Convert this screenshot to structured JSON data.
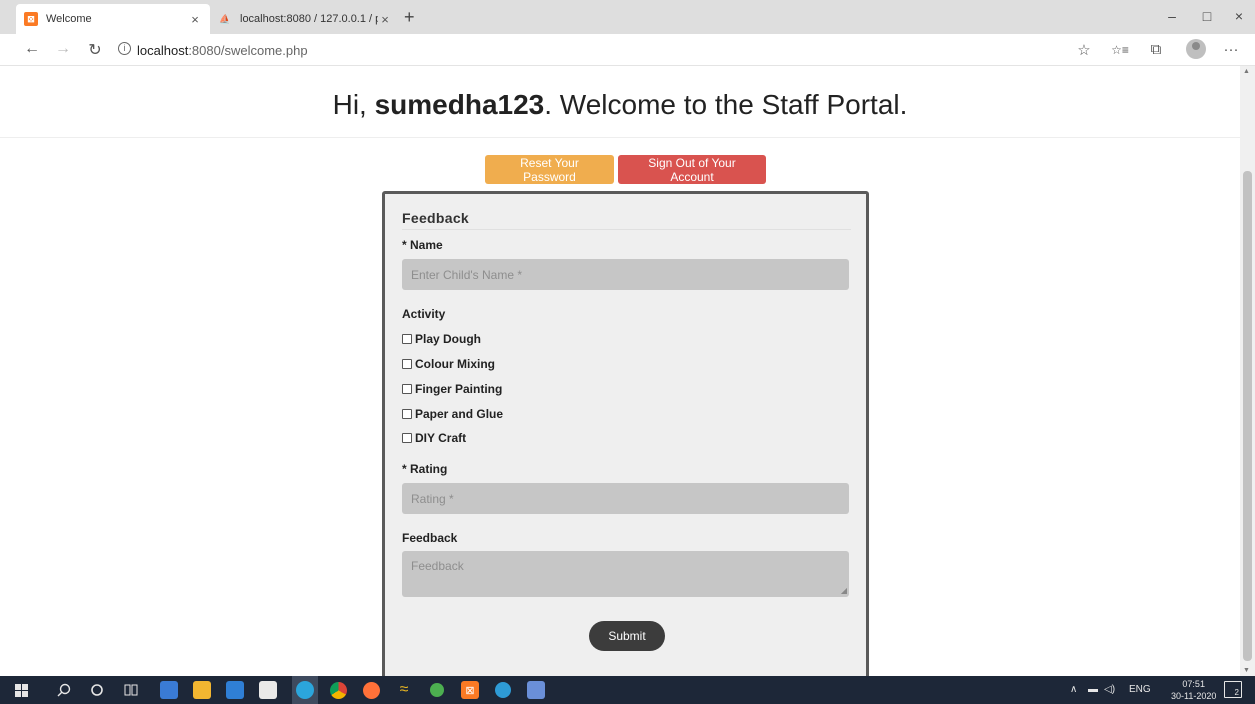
{
  "browser": {
    "tabs": [
      {
        "title": "Welcome",
        "close": "×"
      },
      {
        "title": "localhost:8080 / 127.0.0.1 / paren",
        "close": "×"
      }
    ],
    "new_tab": "+",
    "window_controls": {
      "minimize": "–",
      "maximize": "□",
      "close": "×"
    },
    "nav": {
      "back": "←",
      "forward": "→",
      "refresh": "↻"
    },
    "url_host": "localhost",
    "url_path": ":8080/swelcome.php",
    "toolbar": {
      "favorite": "☆",
      "favorites_list": "☆≡",
      "collections": "⧉",
      "more": "···"
    }
  },
  "page": {
    "greeting_prefix": "Hi, ",
    "username": "sumedha123",
    "greeting_suffix": ". Welcome to the Staff Portal.",
    "reset_password_label": "Reset Your Password",
    "sign_out_label": "Sign Out of Your Account",
    "form": {
      "legend": "Feedback",
      "name_label": "* Name",
      "name_placeholder": "Enter Child's Name *",
      "activity_label": "Activity",
      "activities": [
        "Play Dough",
        "Colour Mixing",
        "Finger Painting",
        "Paper and Glue",
        "DIY Craft"
      ],
      "rating_label": "* Rating",
      "rating_placeholder": "Rating *",
      "feedback_label": "Feedback",
      "feedback_placeholder": "Feedback",
      "submit_label": "Submit"
    }
  },
  "taskbar": {
    "language": "ENG",
    "time": "07:51",
    "date": "30-11-2020",
    "notifications": "2"
  },
  "colors": {
    "warning": "#f0ad4e",
    "danger": "#d9534f",
    "taskbar": "#1d2738"
  }
}
